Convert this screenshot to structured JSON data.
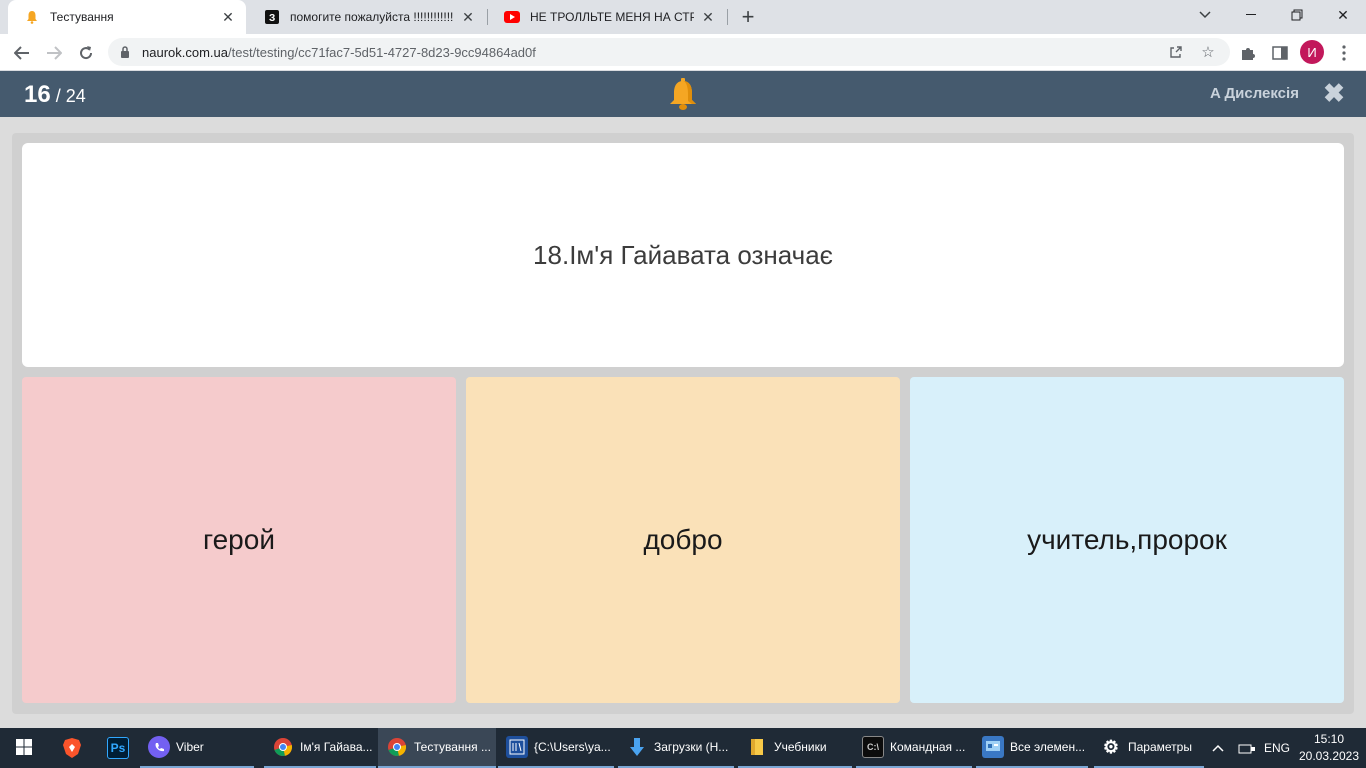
{
  "browser": {
    "tabs": [
      {
        "title": "Тестування",
        "favicon": "bell-favicon",
        "active": true
      },
      {
        "title": "помогите пожалуйста !!!!!!!!!!!!!!!!!!!!",
        "favicon": "znanija-favicon",
        "active": false
      },
      {
        "title": "НЕ ТРОЛЛЬТЕ МЕНЯ НА СТРИМЕ",
        "favicon": "youtube-favicon",
        "active": false
      }
    ],
    "url": {
      "host": "naurok.com.ua",
      "path": "/test/testing/cc71fac7-5d51-4727-8d23-9cc94864ad0f"
    },
    "profile_initial": "И"
  },
  "quiz": {
    "current": "16",
    "separator": " / ",
    "total": "24",
    "dyslexia_label": "Дислексія",
    "question": "18.Ім'я Гайавата означає",
    "answers": [
      "герой",
      "добро",
      "учитель,пророк"
    ],
    "answer_colors": [
      "#f5cbcc",
      "#fae1b8",
      "#d8f0fa"
    ],
    "accent": "#455a6e"
  },
  "taskbar": {
    "items": [
      {
        "label": "",
        "icon": "windows-start-icon"
      },
      {
        "label": "",
        "icon": "brave-icon"
      },
      {
        "label": "",
        "icon": "photoshop-icon",
        "text": "Ps"
      },
      {
        "label": "Viber",
        "icon": "viber-icon"
      },
      {
        "label": "Ім'я Гайава...",
        "icon": "chrome-icon"
      },
      {
        "label": "Тестування ...",
        "icon": "chrome-icon"
      },
      {
        "label": "{C:\\Users\\ya...",
        "icon": "editor-icon"
      },
      {
        "label": "Загрузки (Н...",
        "icon": "download-icon"
      },
      {
        "label": "Учебники",
        "icon": "folder-icon"
      },
      {
        "label": "Командная ...",
        "icon": "cmd-icon"
      },
      {
        "label": "Все элемен...",
        "icon": "control-panel-icon"
      },
      {
        "label": "Параметры",
        "icon": "settings-icon"
      }
    ],
    "language": "ENG",
    "time": "15:10",
    "date": "20.03.2023"
  }
}
